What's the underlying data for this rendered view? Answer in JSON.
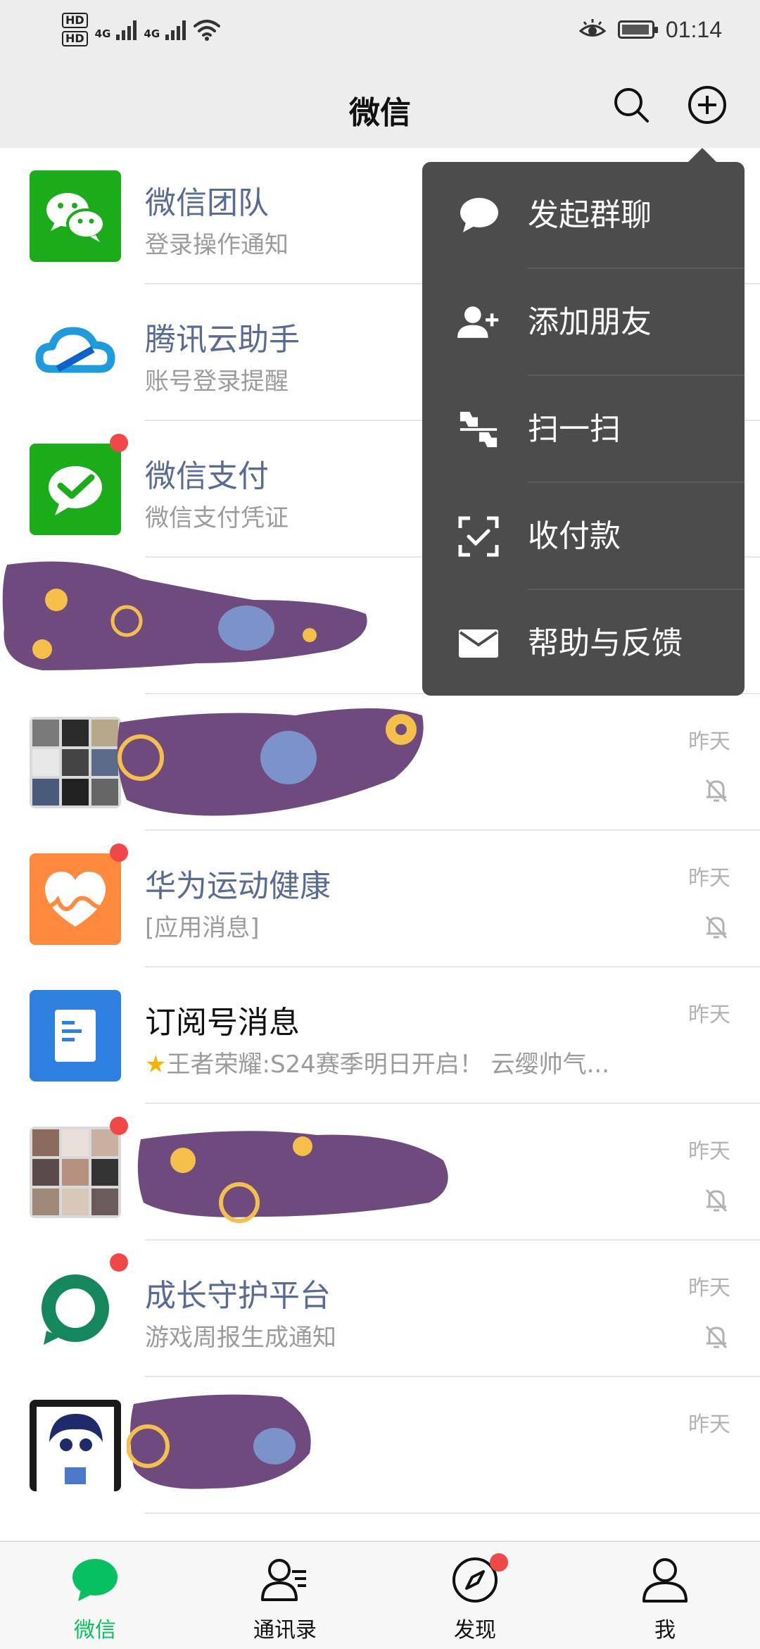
{
  "status_bar": {
    "hd1": "HD",
    "hd2": "HD",
    "net1": "4G",
    "net2": "4G",
    "time": "01:14"
  },
  "header": {
    "title": "微信"
  },
  "chats": [
    {
      "name": "微信团队",
      "message": "登录操作通知",
      "time": "",
      "unread_dot": false,
      "muted": false
    },
    {
      "name": "腾讯云助手",
      "message": "账号登录提醒",
      "time": "",
      "unread_dot": false,
      "muted": false
    },
    {
      "name": "微信支付",
      "message": "微信支付凭证",
      "time": "",
      "unread_dot": true,
      "muted": false
    },
    {
      "name": "",
      "message": "",
      "time": "",
      "unread_dot": false,
      "muted": false
    },
    {
      "name": "",
      "message": "",
      "time": "昨天",
      "unread_dot": false,
      "muted": true
    },
    {
      "name": "华为运动健康",
      "message": "[应用消息]",
      "time": "昨天",
      "unread_dot": true,
      "muted": true
    },
    {
      "name": "订阅号消息",
      "message": "王者荣耀:S24赛季明日开启！ 云缨帅气...",
      "time": "昨天",
      "unread_dot": false,
      "muted": false
    },
    {
      "name": "",
      "message": "",
      "time": "昨天",
      "unread_dot": true,
      "muted": true
    },
    {
      "name": "成长守护平台",
      "message": "游戏周报生成通知",
      "time": "昨天",
      "unread_dot": true,
      "muted": true
    },
    {
      "name": "",
      "message": "",
      "time": "昨天",
      "unread_dot": false,
      "muted": false
    }
  ],
  "popup_menu": {
    "items": [
      {
        "label": "发起群聊",
        "icon": "chat-bubble-icon"
      },
      {
        "label": "添加朋友",
        "icon": "add-friend-icon"
      },
      {
        "label": "扫一扫",
        "icon": "scan-icon"
      },
      {
        "label": "收付款",
        "icon": "payment-icon"
      },
      {
        "label": "帮助与反馈",
        "icon": "mail-icon"
      }
    ]
  },
  "tabs": [
    {
      "label": "微信",
      "icon": "chat-icon",
      "active": true
    },
    {
      "label": "通讯录",
      "icon": "contacts-icon",
      "active": false
    },
    {
      "label": "发现",
      "icon": "compass-icon",
      "active": false,
      "badge": true
    },
    {
      "label": "我",
      "icon": "person-icon",
      "active": false
    }
  ],
  "colors": {
    "wechat_green": "#07c160",
    "header_bg": "#ededed",
    "popup_bg": "#4c4c4c",
    "link_name": "#576b95",
    "badge_red": "#f04848"
  }
}
